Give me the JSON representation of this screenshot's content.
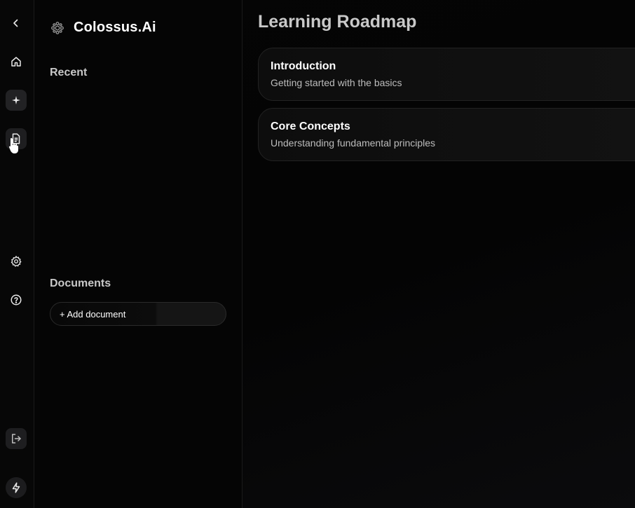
{
  "rail": {
    "items": [
      {
        "name": "chevron-left-icon"
      },
      {
        "name": "home-icon"
      },
      {
        "name": "sparkle-icon"
      },
      {
        "name": "document-icon"
      },
      {
        "name": "gear-icon"
      },
      {
        "name": "help-icon"
      },
      {
        "name": "logout-icon"
      },
      {
        "name": "bolt-icon"
      }
    ]
  },
  "sidebar": {
    "brand": "Colossus.Ai",
    "recent_title": "Recent",
    "documents_title": "Documents",
    "add_document_label": "+ Add document"
  },
  "main": {
    "title": "Learning Roadmap",
    "cards": [
      {
        "title": "Introduction",
        "subtitle": "Getting started with the basics"
      },
      {
        "title": "Core Concepts",
        "subtitle": "Understanding fundamental principles"
      }
    ]
  }
}
